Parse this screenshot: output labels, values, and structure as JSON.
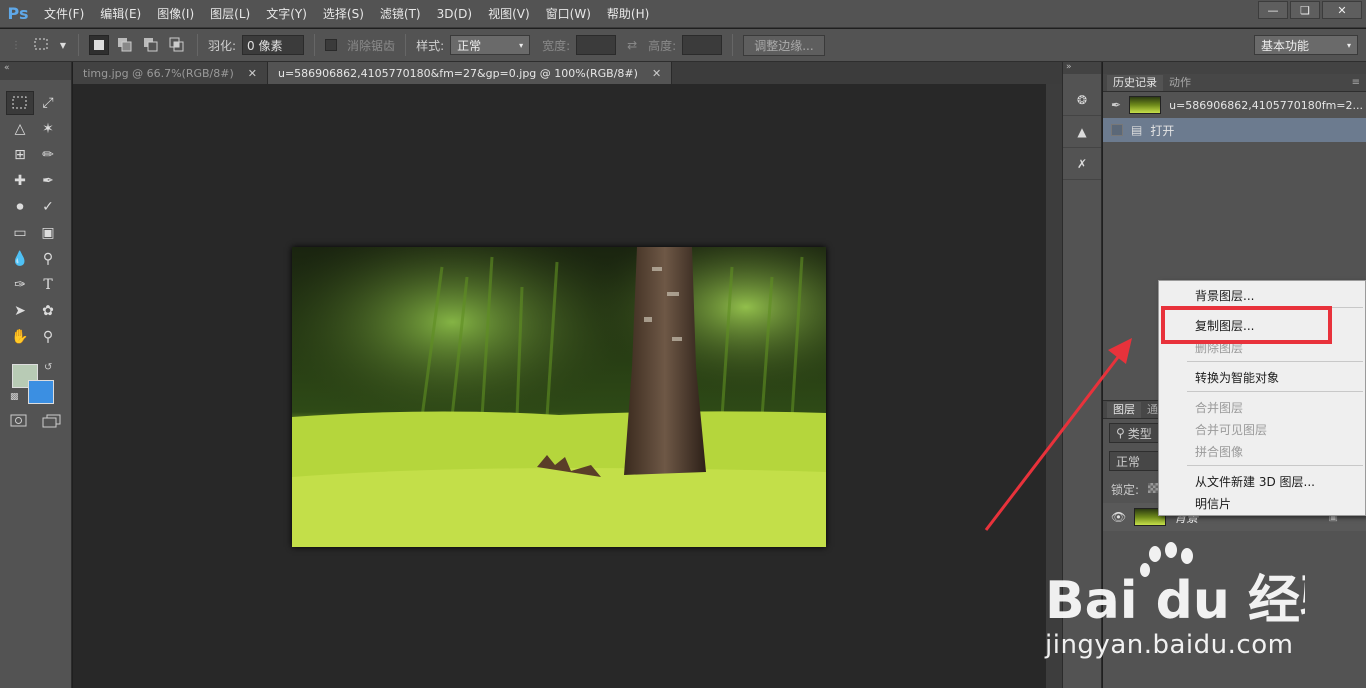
{
  "app": {
    "logo": "Ps",
    "menu": [
      "文件(F)",
      "编辑(E)",
      "图像(I)",
      "图层(L)",
      "文字(Y)",
      "选择(S)",
      "滤镜(T)",
      "3D(D)",
      "视图(V)",
      "窗口(W)",
      "帮助(H)"
    ],
    "window_controls": [
      "minimize-icon",
      "restore-icon",
      "close-icon"
    ]
  },
  "options": {
    "feather_label": "羽化:",
    "feather_value": "0 像素",
    "antialias_label": "消除锯齿",
    "style_label": "样式:",
    "style_value": "正常",
    "width_label": "宽度:",
    "height_label": "高度:",
    "refine_edge_button": "调整边缘...",
    "workspace_value": "基本功能"
  },
  "tabs": [
    {
      "label": "timg.jpg @ 66.7%(RGB/8#)",
      "active": false
    },
    {
      "label": "u=586906862,4105770180&fm=27&gp=0.jpg @ 100%(RGB/8#)",
      "active": true
    }
  ],
  "colors": {
    "foreground": "#b8cbb5",
    "background": "#3b8fe2",
    "highlight": "#e8323b"
  },
  "history_panel": {
    "tabs": [
      "历史记录",
      "动作"
    ],
    "snapshot_name": "u=586906862,4105770180fm=2...",
    "states": [
      "打开"
    ]
  },
  "layers_panel": {
    "tabs": [
      "图层",
      "通"
    ],
    "filter_label": "类型",
    "blend_mode": "正常",
    "lock_label": "锁定:",
    "layer_name": "背景"
  },
  "context_menu": {
    "items": [
      {
        "label": "背景图层...",
        "disabled": false
      },
      {
        "label": "复制图层...",
        "disabled": false
      },
      {
        "label": "删除图层",
        "disabled": true
      },
      {
        "label": "转换为智能对象",
        "disabled": false
      },
      {
        "label": "合并图层",
        "disabled": true
      },
      {
        "label": "合并可见图层",
        "disabled": true
      },
      {
        "label": "拼合图像",
        "disabled": true
      },
      {
        "label": "从文件新建 3D 图层...",
        "disabled": false
      },
      {
        "label": "明信片",
        "disabled": false
      }
    ]
  },
  "watermark": {
    "brand": "Bai du 经验",
    "url": "jingyan.baidu.com"
  }
}
